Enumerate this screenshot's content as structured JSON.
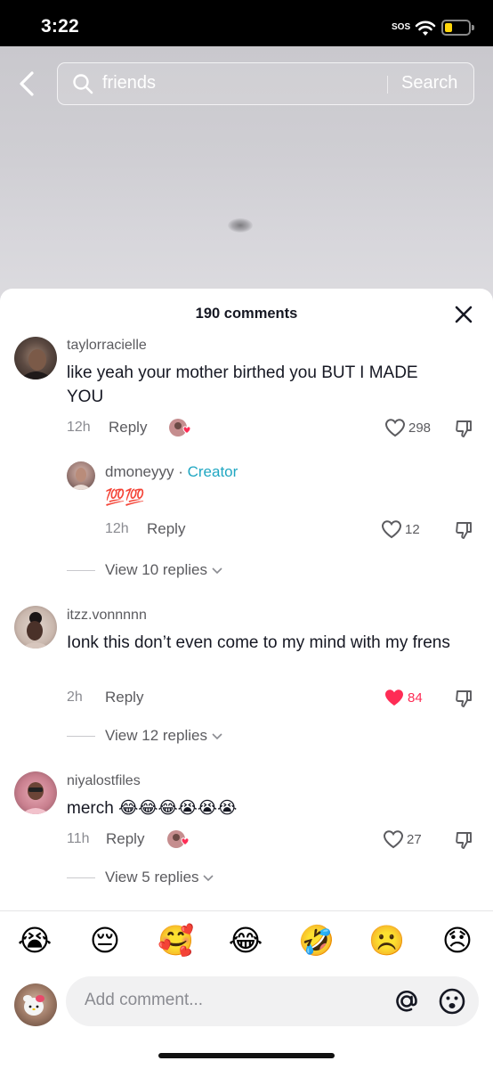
{
  "status_bar": {
    "time": "3:22",
    "sos": "SOS"
  },
  "search": {
    "query": "friends",
    "button_label": "Search"
  },
  "comments_header": {
    "count_label": "190 comments"
  },
  "comments": [
    {
      "username": "taylorracielle",
      "text": "like yeah your mother birthed you BUT I MADE YOU",
      "time": "12h",
      "reply_label": "Reply",
      "likes": "298",
      "liked": false,
      "creator_liked": true
    },
    {
      "username": "itzz.vonnnnn",
      "text": "Ionk this don’t even come to my mind with my frens",
      "time": "2h",
      "reply_label": "Reply",
      "likes": "84",
      "liked": true,
      "creator_liked": false,
      "view_replies": "View 12 replies"
    },
    {
      "username": "niyalostfiles",
      "text": "merch 😂😂😂😭😭😭",
      "time": "11h",
      "reply_label": "Reply",
      "likes": "27",
      "liked": false,
      "creator_liked": true,
      "view_replies": "View 5 replies"
    }
  ],
  "creator_reply": {
    "username": "dmoneyyy",
    "separator": " · ",
    "badge": "Creator",
    "text": "💯💯",
    "time": "12h",
    "reply_label": "Reply",
    "likes": "12",
    "view_replies": "View 10 replies"
  },
  "quick_emojis": [
    "😭",
    "😔",
    "🥰",
    "😂",
    "🤣",
    "☹️",
    "😞"
  ],
  "composer": {
    "placeholder": "Add comment..."
  },
  "colors": {
    "accent_like": "#fe2c55",
    "creator_badge": "#20a7c2"
  }
}
